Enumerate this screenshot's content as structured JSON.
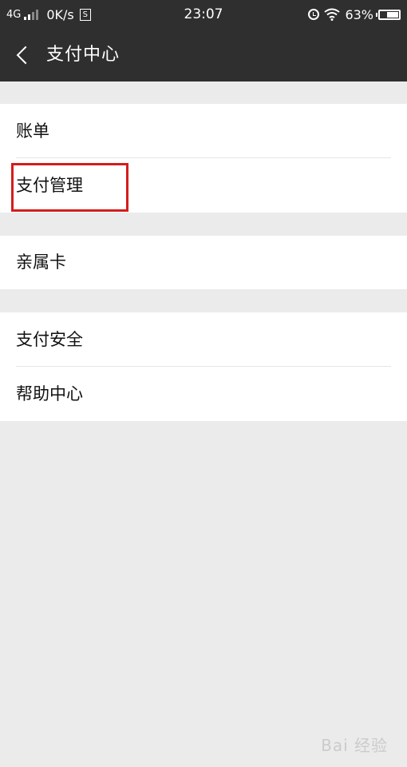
{
  "status_bar": {
    "network": "4G",
    "speed": "0K/s",
    "s_icon_label": "S",
    "time": "23:07",
    "battery": "63%",
    "battery_level": 0.63
  },
  "header": {
    "title": "支付中心"
  },
  "groups": [
    {
      "items": [
        {
          "label": "账单"
        },
        {
          "label": "支付管理"
        }
      ]
    },
    {
      "items": [
        {
          "label": "亲属卡"
        }
      ]
    },
    {
      "items": [
        {
          "label": "支付安全"
        },
        {
          "label": "帮助中心"
        }
      ]
    }
  ],
  "annotation": {
    "color": "#d41d1d"
  },
  "watermark": {
    "text": "Bai 经验"
  }
}
